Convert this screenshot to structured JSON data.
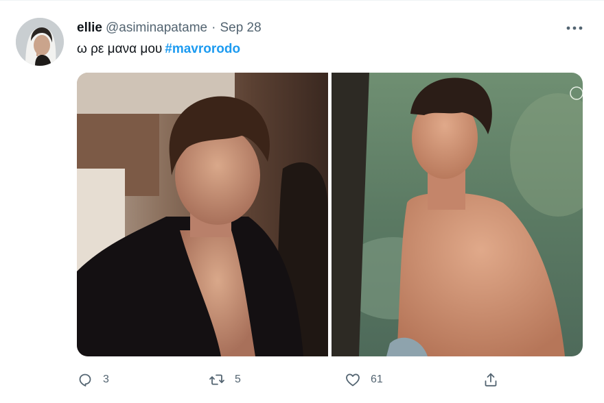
{
  "tweet": {
    "display_name": "ellie",
    "handle": "@asiminapatame",
    "separator": "·",
    "date": "Sep 28",
    "text": "ω ρε μανα μου",
    "hashtag": "#mavrorodo"
  },
  "actions": {
    "reply_count": "3",
    "retweet_count": "5",
    "like_count": "61"
  },
  "icons": {
    "more": "more-horizontal-icon",
    "reply": "reply-icon",
    "retweet": "retweet-icon",
    "like": "heart-icon",
    "share": "share-icon"
  },
  "colors": {
    "link": "#1d9bf0",
    "secondary_text": "#536471",
    "primary_text": "#0f1419"
  }
}
